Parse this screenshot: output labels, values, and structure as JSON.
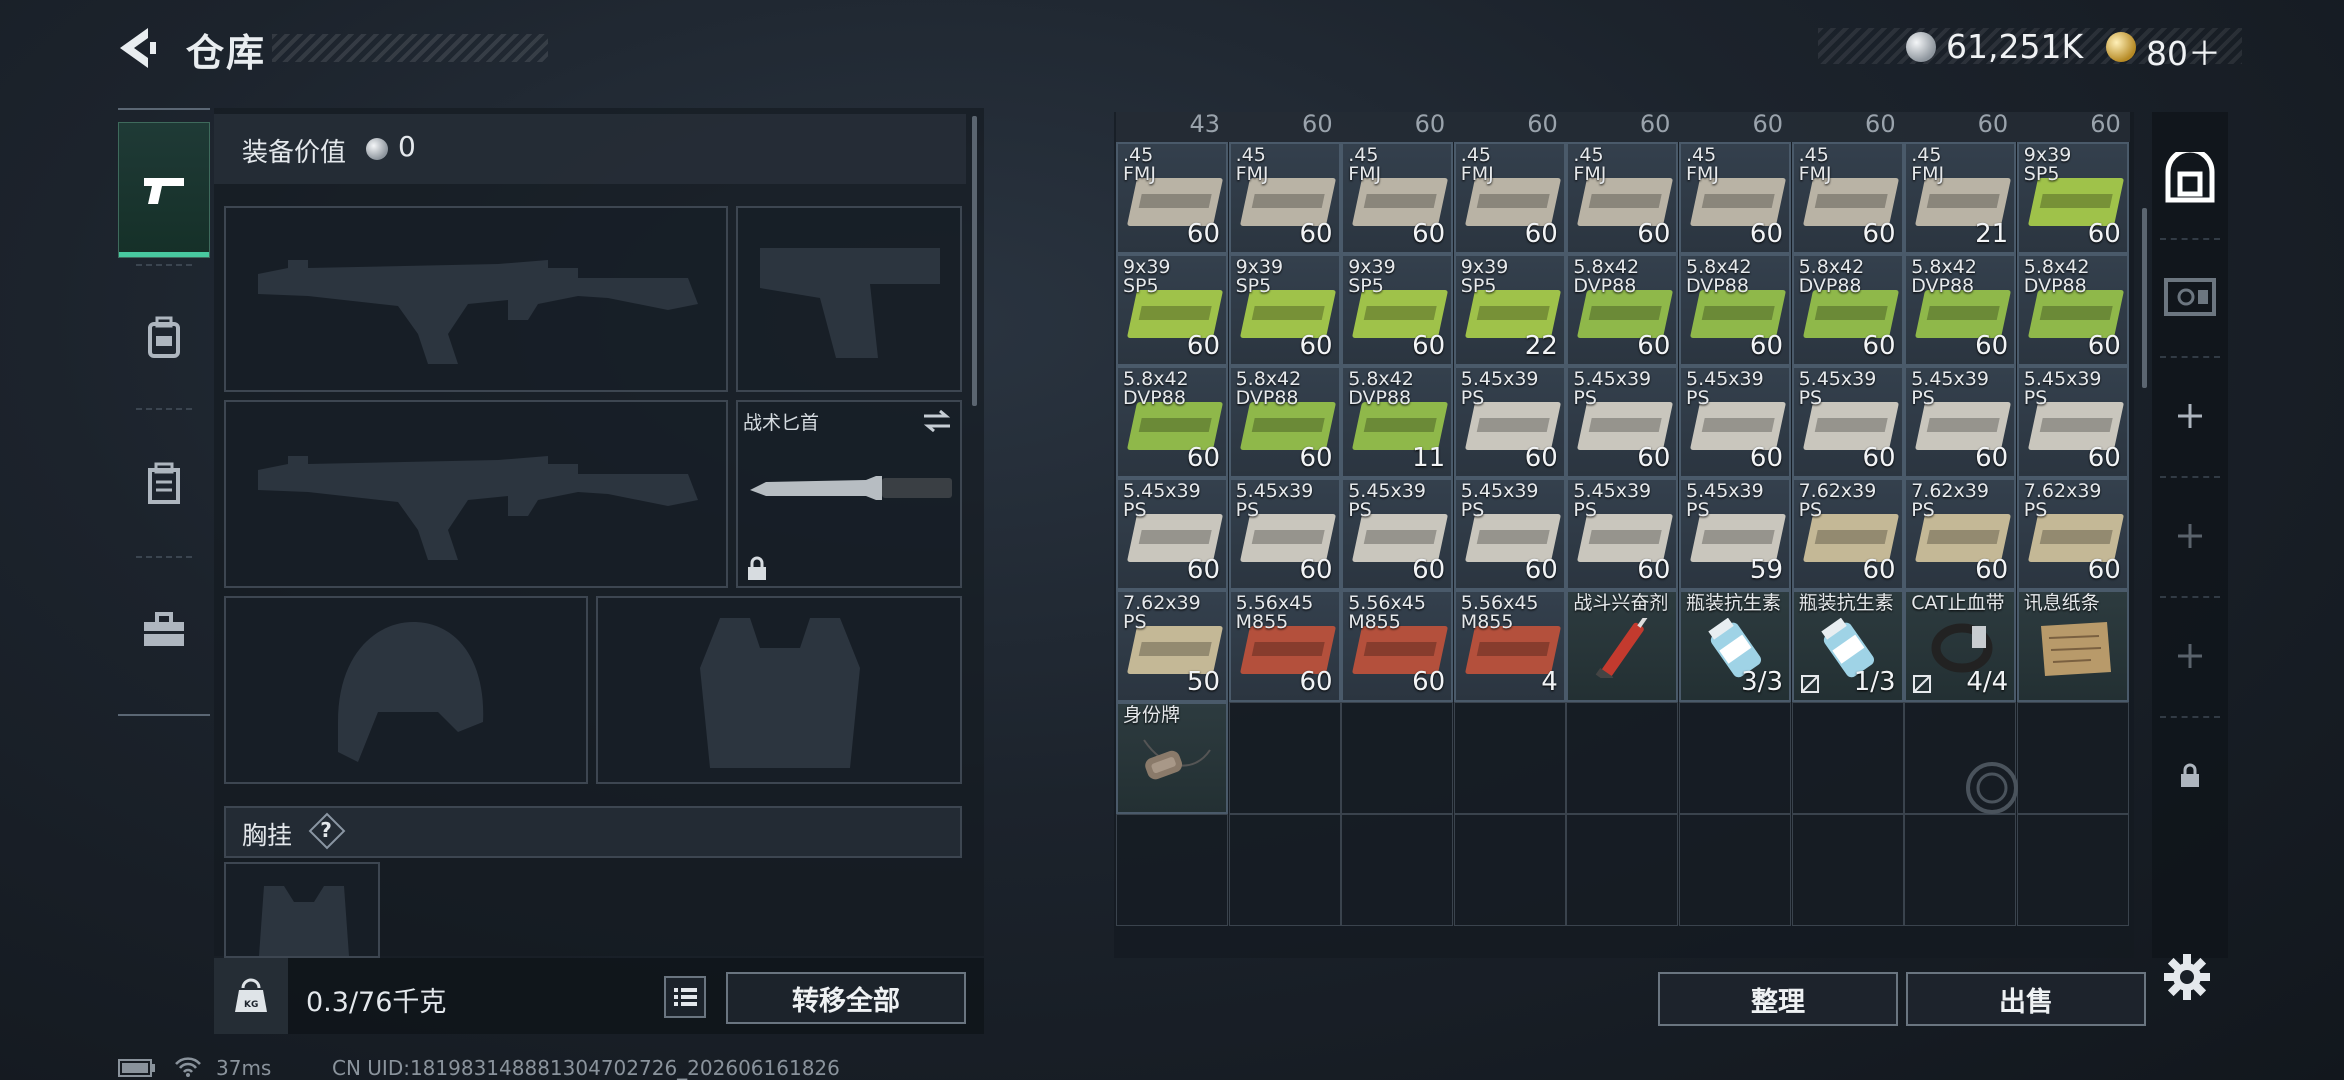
{
  "header": {
    "title": "仓库",
    "silver_amount": "61,251K",
    "gold_amount": "80＋"
  },
  "equipment": {
    "value_label": "装备价值",
    "value": "0",
    "knife_label": "战术匕首",
    "chest_rig_label": "胸挂",
    "chest_rig_help": "?",
    "weight": "0.3/76千克",
    "transfer_all_label": "转移全部"
  },
  "storage": {
    "column_tops": [
      "43",
      "60",
      "60",
      "60",
      "60",
      "60",
      "60",
      "60",
      "60"
    ],
    "items": [
      {
        "name": ".45\nFMJ",
        "count": "60",
        "kind": "ammo",
        "color": "#b9b3a5"
      },
      {
        "name": ".45\nFMJ",
        "count": "60",
        "kind": "ammo",
        "color": "#b9b3a5"
      },
      {
        "name": ".45\nFMJ",
        "count": "60",
        "kind": "ammo",
        "color": "#b9b3a5"
      },
      {
        "name": ".45\nFMJ",
        "count": "60",
        "kind": "ammo",
        "color": "#b9b3a5"
      },
      {
        "name": ".45\nFMJ",
        "count": "60",
        "kind": "ammo",
        "color": "#b9b3a5"
      },
      {
        "name": ".45\nFMJ",
        "count": "60",
        "kind": "ammo",
        "color": "#b9b3a5"
      },
      {
        "name": ".45\nFMJ",
        "count": "60",
        "kind": "ammo",
        "color": "#b9b3a5"
      },
      {
        "name": ".45\nFMJ",
        "count": "21",
        "kind": "ammo",
        "color": "#b9b3a5"
      },
      {
        "name": "9x39\nSP5",
        "count": "60",
        "kind": "ammo",
        "color": "#9fc24a"
      },
      {
        "name": "9x39\nSP5",
        "count": "60",
        "kind": "ammo",
        "color": "#9fc24a"
      },
      {
        "name": "9x39\nSP5",
        "count": "60",
        "kind": "ammo",
        "color": "#9fc24a"
      },
      {
        "name": "9x39\nSP5",
        "count": "60",
        "kind": "ammo",
        "color": "#9fc24a"
      },
      {
        "name": "9x39\nSP5",
        "count": "22",
        "kind": "ammo",
        "color": "#9fc24a"
      },
      {
        "name": "5.8x42\nDVP88",
        "count": "60",
        "kind": "ammo",
        "color": "#8fb84a"
      },
      {
        "name": "5.8x42\nDVP88",
        "count": "60",
        "kind": "ammo",
        "color": "#8fb84a"
      },
      {
        "name": "5.8x42\nDVP88",
        "count": "60",
        "kind": "ammo",
        "color": "#8fb84a"
      },
      {
        "name": "5.8x42\nDVP88",
        "count": "60",
        "kind": "ammo",
        "color": "#8fb84a"
      },
      {
        "name": "5.8x42\nDVP88",
        "count": "60",
        "kind": "ammo",
        "color": "#8fb84a"
      },
      {
        "name": "5.8x42\nDVP88",
        "count": "60",
        "kind": "ammo",
        "color": "#8fb84a"
      },
      {
        "name": "5.8x42\nDVP88",
        "count": "60",
        "kind": "ammo",
        "color": "#8fb84a"
      },
      {
        "name": "5.8x42\nDVP88",
        "count": "11",
        "kind": "ammo",
        "color": "#8fb84a"
      },
      {
        "name": "5.45x39\nPS",
        "count": "60",
        "kind": "ammo",
        "color": "#c9c6bd"
      },
      {
        "name": "5.45x39\nPS",
        "count": "60",
        "kind": "ammo",
        "color": "#c9c6bd"
      },
      {
        "name": "5.45x39\nPS",
        "count": "60",
        "kind": "ammo",
        "color": "#c9c6bd"
      },
      {
        "name": "5.45x39\nPS",
        "count": "60",
        "kind": "ammo",
        "color": "#c9c6bd"
      },
      {
        "name": "5.45x39\nPS",
        "count": "60",
        "kind": "ammo",
        "color": "#c9c6bd"
      },
      {
        "name": "5.45x39\nPS",
        "count": "60",
        "kind": "ammo",
        "color": "#c9c6bd"
      },
      {
        "name": "5.45x39\nPS",
        "count": "60",
        "kind": "ammo",
        "color": "#c9c6bd"
      },
      {
        "name": "5.45x39\nPS",
        "count": "60",
        "kind": "ammo",
        "color": "#c9c6bd"
      },
      {
        "name": "5.45x39\nPS",
        "count": "60",
        "kind": "ammo",
        "color": "#c9c6bd"
      },
      {
        "name": "5.45x39\nPS",
        "count": "60",
        "kind": "ammo",
        "color": "#c9c6bd"
      },
      {
        "name": "5.45x39\nPS",
        "count": "60",
        "kind": "ammo",
        "color": "#c9c6bd"
      },
      {
        "name": "5.45x39\nPS",
        "count": "59",
        "kind": "ammo",
        "color": "#c9c6bd"
      },
      {
        "name": "7.62x39\nPS",
        "count": "60",
        "kind": "ammo",
        "color": "#c4b896"
      },
      {
        "name": "7.62x39\nPS",
        "count": "60",
        "kind": "ammo",
        "color": "#c4b896"
      },
      {
        "name": "7.62x39\nPS",
        "count": "60",
        "kind": "ammo",
        "color": "#c4b896"
      },
      {
        "name": "7.62x39\nPS",
        "count": "50",
        "kind": "ammo",
        "color": "#c4b896"
      },
      {
        "name": "5.56x45\nM855",
        "count": "60",
        "kind": "ammo",
        "color": "#b4503c"
      },
      {
        "name": "5.56x45\nM855",
        "count": "60",
        "kind": "ammo",
        "color": "#b4503c"
      },
      {
        "name": "5.56x45\nM855",
        "count": "4",
        "kind": "ammo",
        "color": "#b4503c"
      },
      {
        "name": "战斗兴奋剂",
        "count": "",
        "kind": "stim",
        "color": "#c33a2e"
      },
      {
        "name": "瓶装抗生素",
        "count": "3/3",
        "kind": "bottle",
        "color": "#9fd3e6"
      },
      {
        "name": "瓶装抗生素",
        "count": "1/3",
        "kind": "bottle",
        "color": "#9fd3e6"
      },
      {
        "name": "CAT止血带",
        "count": "4/4",
        "kind": "tourniquet",
        "color": "#222222"
      },
      {
        "name": "讯息纸条",
        "count": "",
        "kind": "paper",
        "color": "#b89a6a"
      },
      {
        "name": "身份牌",
        "count": "",
        "kind": "dogtag",
        "color": "#8a7a6a"
      }
    ],
    "sort_label": "整理",
    "sell_label": "出售"
  },
  "status_bar": {
    "ping": "37ms",
    "uid": "CN UID:181983148881304702726_202606161826"
  },
  "icons": [
    "back-arrow-icon",
    "pistol-icon",
    "backpack-icon",
    "rig-icon",
    "toolbox-icon",
    "weight-icon",
    "list-icon",
    "safe-icon",
    "case-icon",
    "plus-icon",
    "lock-icon",
    "settings-gear-icon",
    "swap-icon",
    "battery-icon",
    "wifi-icon"
  ]
}
